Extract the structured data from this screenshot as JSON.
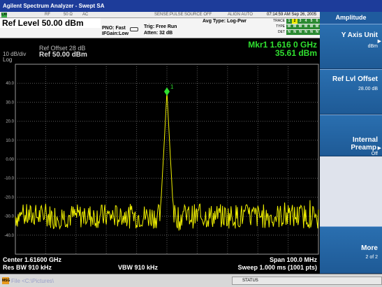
{
  "window": {
    "title": "Agilent Spectrum Analyzer - Swept SA"
  },
  "status_bar": {
    "lxi": "LXI",
    "rf": "RF",
    "impedance": "50 Ω",
    "coupling": "AC",
    "sense": "SENSE:PULSE",
    "source": "SOURCE OFF",
    "align": "ALIGN AUTO",
    "datetime": "07:14:59 AM Sep 26, 2005"
  },
  "header": {
    "ref_level": "Ref Level 50.00 dBm",
    "pno": "PNO: Fast",
    "ifgain": "IFGain:Low",
    "trig": "Trig: Free Run",
    "atten": "Atten: 32 dB",
    "avg_type": "Avg Type: Log-Pwr",
    "trace_label": "TRACE",
    "type_label": "TYPE",
    "det_label": "DET",
    "trace_cells": [
      "1",
      "2",
      "3",
      "4",
      "5",
      "6"
    ],
    "type_cells": [
      "W",
      "W",
      "W",
      "W",
      "W",
      "W"
    ],
    "det_cells": [
      "N",
      "N",
      "N",
      "N",
      "N",
      "N"
    ]
  },
  "display": {
    "marker_freq": "Mkr1 1.616 0 GHz",
    "marker_amp": "35.61 dBm",
    "scale": "10 dB/div",
    "scale_type": "Log",
    "ref_offset": "Ref Offset 28 dB",
    "ref_value": "Ref 50.00 dBm",
    "marker_number": "1",
    "y_ticks": [
      "40.0",
      "30.0",
      "20.0",
      "10.0",
      "0.00",
      "-10.0",
      "-20.0",
      "-30.0",
      "-40.0"
    ],
    "trace_color": "#f0f000",
    "marker_color": "#30e030"
  },
  "footer": {
    "center": "Center 1.61600 GHz",
    "res_bw": "Res BW 910 kHz",
    "vbw": "VBW 910 kHz",
    "span": "Span 100.0 MHz",
    "sweep": "Sweep  1.000 ms (1001 pts)"
  },
  "message_bar": {
    "icon": "MSG",
    "text": "File <C:\\Pictures\\",
    "status": "STATUS"
  },
  "softkeys": {
    "menu_title": "Amplitude",
    "keys": [
      {
        "label1": "Y Axis Unit",
        "value": "dBm"
      },
      {
        "label1": "Ref Lvl Offset",
        "value": "28.00 dB"
      },
      {
        "label1": "Internal",
        "label2": "Preamp",
        "value": "Off"
      },
      {
        "label1": "More",
        "value": "2 of 2"
      }
    ]
  }
}
